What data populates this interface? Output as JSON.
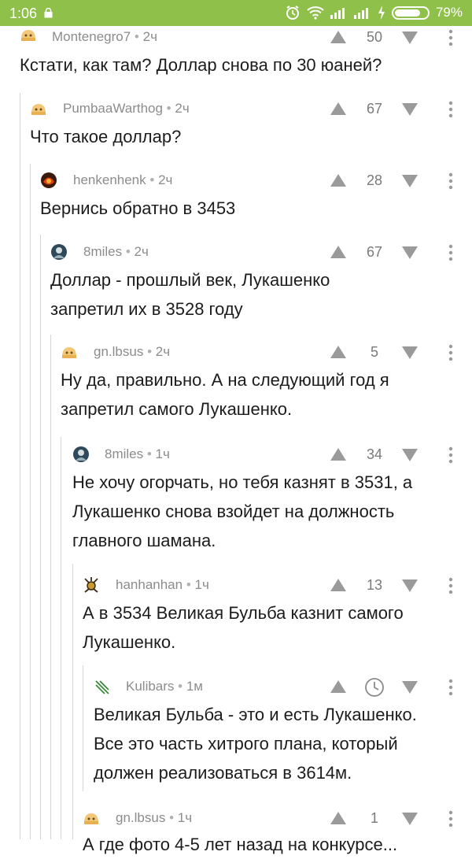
{
  "status_bar": {
    "time": "1:06",
    "battery": "79%"
  },
  "comments": [
    {
      "user": "Montenegro7",
      "time": "2ч",
      "score": "50",
      "lines": [
        "Кстати, как там? Доллар снова по 30 юаней?"
      ]
    },
    {
      "user": "PumbaaWarthog",
      "time": "2ч",
      "score": "67",
      "lines": [
        "Что такое доллар?"
      ]
    },
    {
      "user": "henkenhenk",
      "time": "2ч",
      "score": "28",
      "lines": [
        "Вернись обратно в 3453"
      ]
    },
    {
      "user": "8miles",
      "time": "2ч",
      "score": "67",
      "lines": [
        "Доллар - прошлый век, Лукашенко",
        "запретил их в 3528 году"
      ]
    },
    {
      "user": "gn.lbsus",
      "time": "2ч",
      "score": "5",
      "lines": [
        "Ну да, правильно. А на следующий год я",
        "запретил самого Лукашенко."
      ]
    },
    {
      "user": "8miles",
      "time": "1ч",
      "score": "34",
      "lines": [
        "Не хочу огорчать, но тебя казнят в 3531, а",
        "Лукашенко снова взойдет на должность",
        "главного шамана."
      ]
    },
    {
      "user": "hanhanhan",
      "time": "1ч",
      "score": "13",
      "lines": [
        "А в 3534 Великая Бульба казнит самого",
        "Лукашенко."
      ]
    },
    {
      "user": "Kulibars",
      "time": "1м",
      "score": "",
      "lines": [
        "Великая Бульба - это и есть Лукашенко.",
        "Все это часть хитрого плана, который",
        "должен реализоваться в 3614м."
      ]
    },
    {
      "user": "gn.lbsus",
      "time": "1ч",
      "score": "1",
      "lines": [
        "А где фото 4-5 лет назад на конкурсе..."
      ]
    }
  ],
  "colors": {
    "status_bar": "#8fc04a",
    "meta_text": "#8c8c8c",
    "vote_icon": "#9a9a9a",
    "thread_line": "#d5d5d5"
  },
  "icons": [
    "upvote-icon",
    "downvote-icon",
    "more-icon",
    "timer-icon"
  ]
}
